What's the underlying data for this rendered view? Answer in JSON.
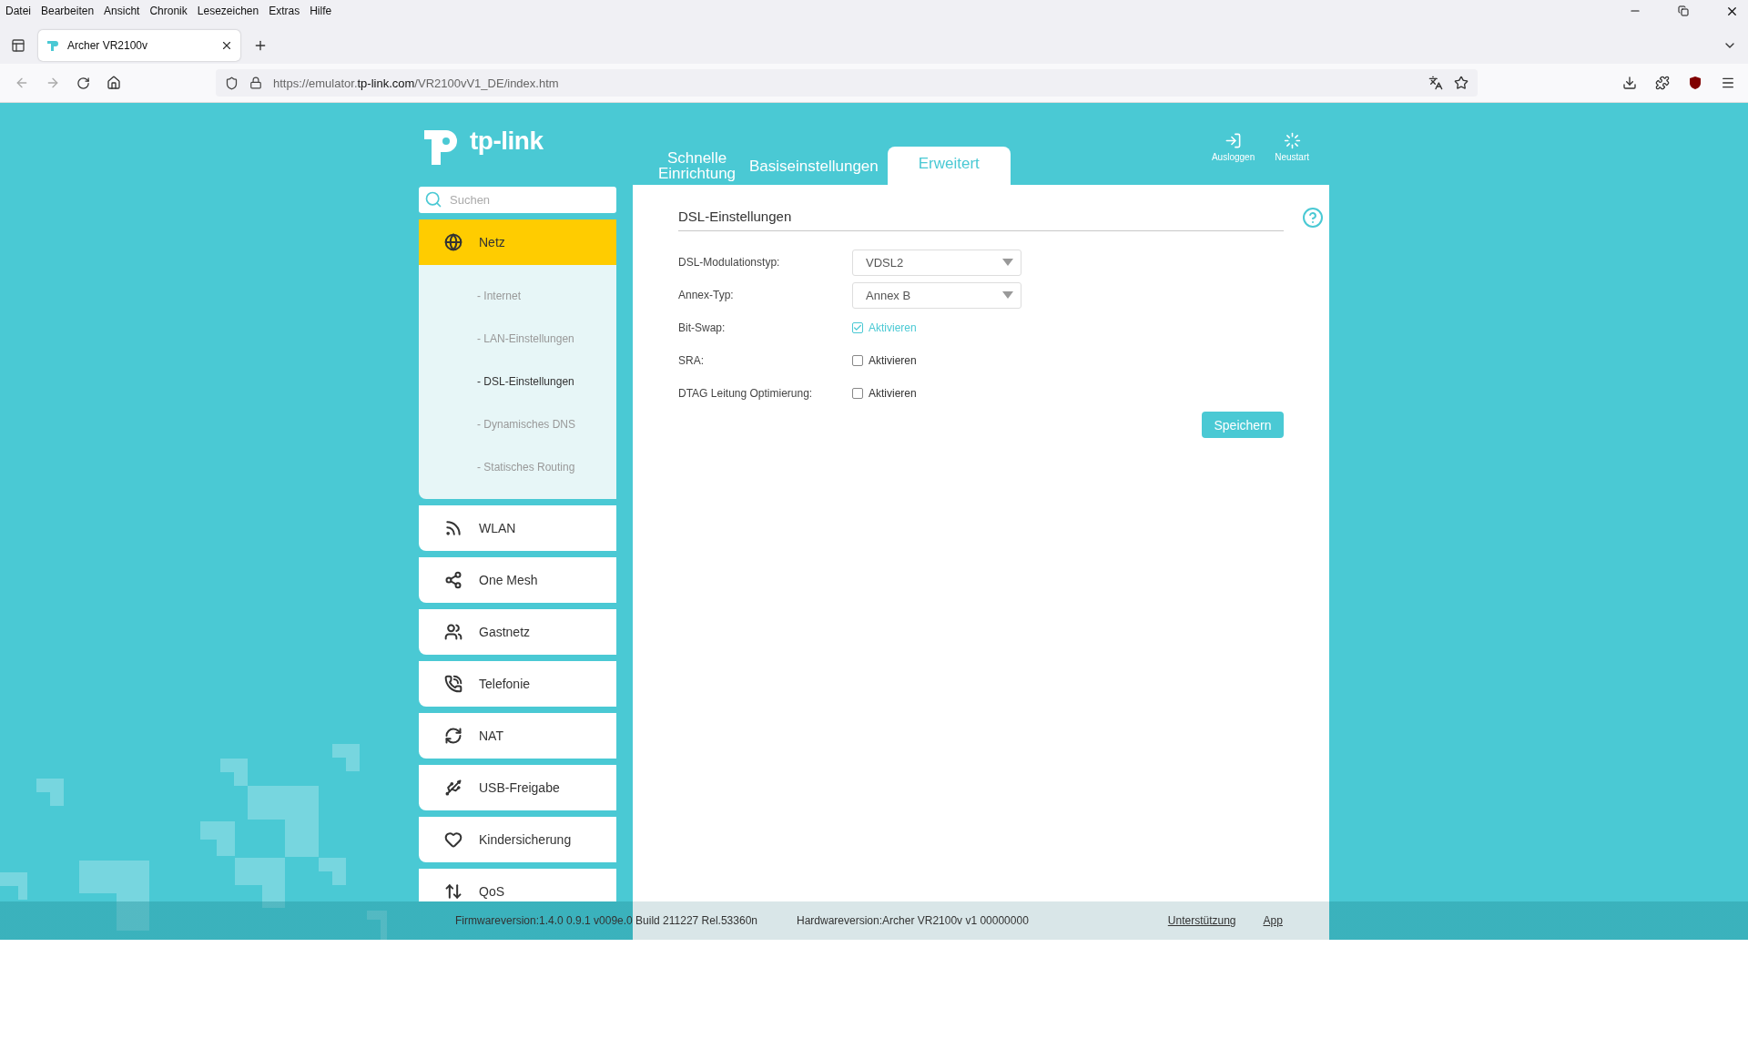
{
  "browser": {
    "menu": [
      "Datei",
      "Bearbeiten",
      "Ansicht",
      "Chronik",
      "Lesezeichen",
      "Extras",
      "Hilfe"
    ],
    "tab": {
      "title": "Archer VR2100v"
    },
    "url": "https://emulator.**tp-link.com**/VR2100vV1_DE/index.htm"
  },
  "router": {
    "logo": "tp-link",
    "nav_tabs": [
      {
        "label": "Schnelle Einrichtung",
        "selected": false
      },
      {
        "label": "Basiseinstellungen",
        "selected": false
      },
      {
        "label": "Erweitert",
        "selected": true
      }
    ],
    "header_actions": [
      {
        "label": "Ausloggen",
        "kind": "logout"
      },
      {
        "label": "Neustart",
        "kind": "reboot"
      }
    ],
    "search": {
      "placeholder": "Suchen"
    },
    "sidebar": {
      "items": [
        {
          "label": "Netz",
          "kind": "globe",
          "selected": true,
          "expanded": true,
          "children": [
            {
              "label": "- Internet",
              "selected": false
            },
            {
              "label": "- LAN-Einstellungen",
              "selected": false
            },
            {
              "label": "- DSL-Einstellungen",
              "selected": true
            },
            {
              "label": "- Dynamisches DNS",
              "selected": false
            },
            {
              "label": "- Statisches Routing",
              "selected": false
            }
          ]
        },
        {
          "label": "WLAN",
          "kind": "wifi",
          "selected": false,
          "expanded": false
        },
        {
          "label": "One Mesh",
          "kind": "mesh",
          "selected": false,
          "expanded": false
        },
        {
          "label": "Gastnetz",
          "kind": "guests",
          "selected": false,
          "expanded": false
        },
        {
          "label": "Telefonie",
          "kind": "phone",
          "selected": false,
          "expanded": false
        },
        {
          "label": "NAT",
          "kind": "nat",
          "selected": false,
          "expanded": false
        },
        {
          "label": "USB-Freigabe",
          "kind": "usb",
          "selected": false,
          "expanded": false
        },
        {
          "label": "Kindersicherung",
          "kind": "heart",
          "selected": false,
          "expanded": false
        },
        {
          "label": "QoS",
          "kind": "qos",
          "selected": false,
          "expanded": false
        }
      ]
    },
    "panel": {
      "title": "DSL-Einstellungen",
      "fields": [
        {
          "label": "DSL-Modulationstyp:",
          "kind": "select",
          "value": "VDSL2"
        },
        {
          "label": "Annex-Typ:",
          "kind": "select",
          "value": "Annex B"
        },
        {
          "label": "Bit-Swap:",
          "kind": "checkbox",
          "option": "Aktivieren",
          "checked": true
        },
        {
          "label": "SRA:",
          "kind": "checkbox",
          "option": "Aktivieren",
          "checked": false
        },
        {
          "label": "DTAG Leitung Optimierung:",
          "kind": "checkbox",
          "option": "Aktivieren",
          "checked": false
        }
      ],
      "save_button": "Speichern"
    },
    "footer": {
      "firmware": "Firmwareversion:1.4.0 0.9.1 v009e.0 Build 211227 Rel.53360n",
      "hardware": "Hardwareversion:Archer VR2100v v1 00000000",
      "links": [
        "Unterstützung",
        "App"
      ]
    }
  }
}
